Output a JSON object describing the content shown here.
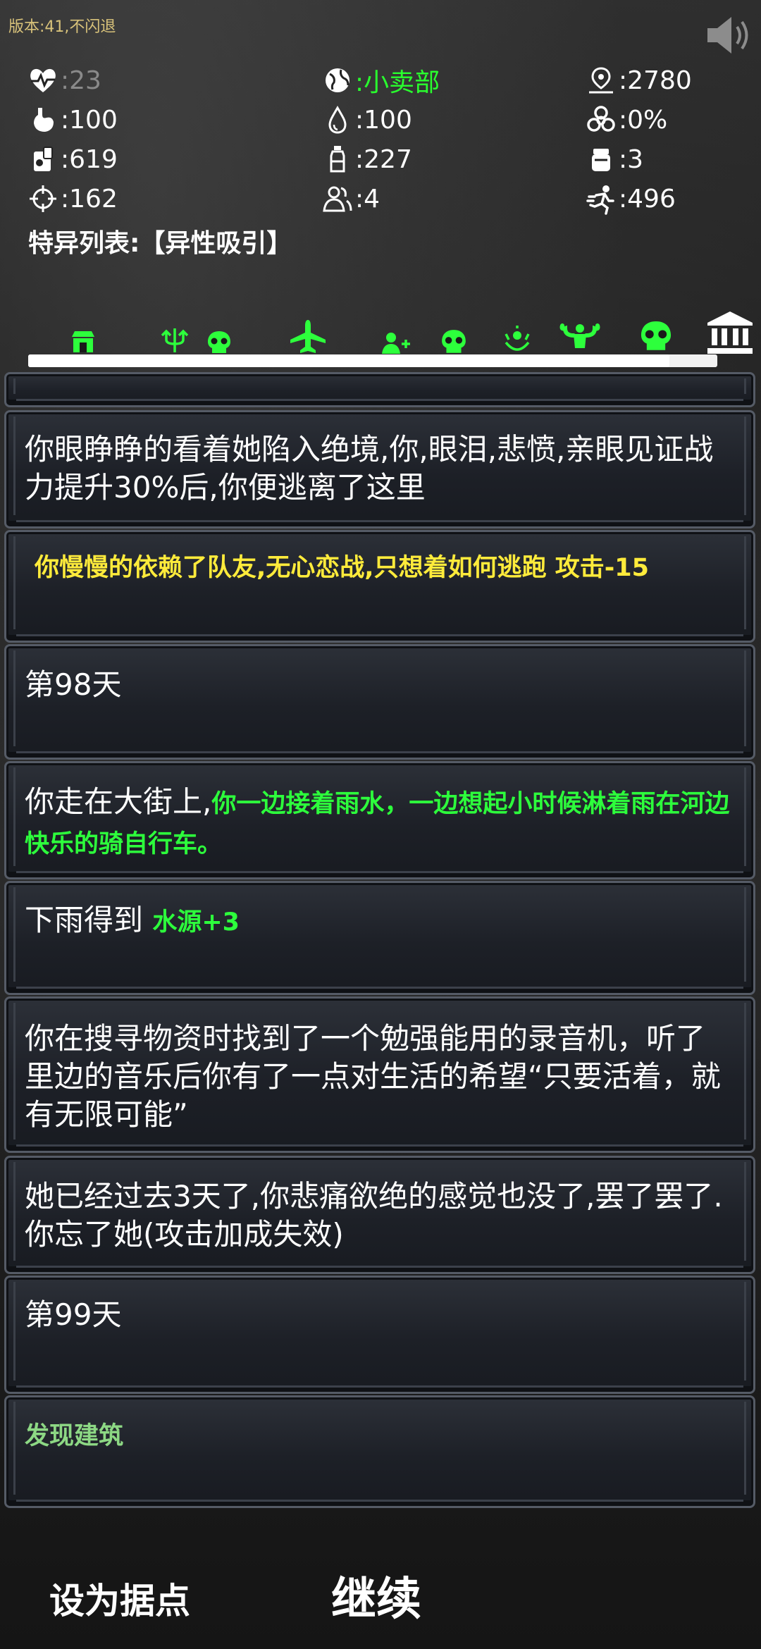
{
  "version": "版本:41,不闪退",
  "stats": {
    "health": ":23",
    "location": ":小卖部",
    "distance": ":2780",
    "hunger": ":100",
    "thirst": ":100",
    "infection": ":0%",
    "food": ":619",
    "water": ":227",
    "item3": ":3",
    "attack": ":162",
    "team": ":4",
    "speed": ":496"
  },
  "traits": "特异列表:【异性吸引】",
  "progress": {
    "fraction": 0.93
  },
  "timeline_icons": [
    "shop-icon",
    "trident-icon",
    "skull-icon",
    "airplane-icon",
    "add-person-icon",
    "skull-icon",
    "mutation-icon",
    "strongman-icon",
    "skull-icon",
    "bank-icon"
  ],
  "colors": {
    "highlight_green": "#2dff3c",
    "warning_yellow": "#ffeb3b",
    "dim_green": "#8dd884"
  },
  "log": [
    {
      "text": "你眼睁睁的看着她陷入绝境,你,眼泪,悲愤,亲眼见证战力提升30%后,你便逃离了这里"
    },
    {
      "yellow": "你慢慢的依赖了队友,无心恋战,只想着如何逃跑 攻击-15"
    },
    {
      "text": "第98天"
    },
    {
      "text": "你走在大街上,",
      "green": "你一边接着雨水，一边想起小时候淋着雨在河边快乐的骑自行车。"
    },
    {
      "text": "下雨得到 ",
      "green": "水源+3"
    },
    {
      "text": "你在搜寻物资时找到了一个勉强能用的录音机，听了里边的音乐后你有了一点对生活的希望“只要活着，就有无限可能”"
    },
    {
      "text": "她已经过去3天了,你悲痛欲绝的感觉也没了,罢了罢了.你忘了她(攻击加成失效)"
    },
    {
      "text": "第99天"
    },
    {
      "green": "发现建筑"
    }
  ],
  "buttons": {
    "set_base": "设为据点",
    "continue": "继续"
  }
}
